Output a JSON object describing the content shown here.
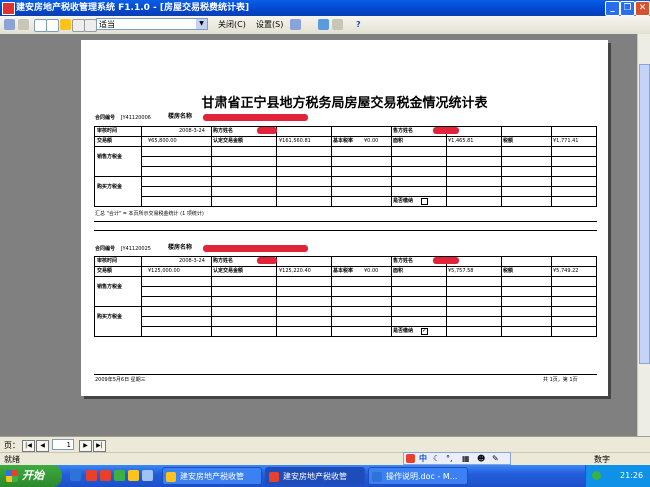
{
  "window": {
    "title": "建安房地产税收管理系统 F1.1.0 - [房屋交易税费统计表]",
    "minimize_icon": "minimize-icon",
    "maximize_icon": "restore-icon",
    "close_icon": "close-icon"
  },
  "toolbar": {
    "zoom_value": "适当",
    "close_label": "关闭(C)",
    "setup_label": "设置(S)",
    "help_glyph": "?"
  },
  "report": {
    "title": "甘肃省正宁县地方税务局房屋交易税金情况统计表",
    "footer_left": "2009年5月6日 星期三",
    "footer_right": "共 1页，第 1页",
    "record1": {
      "contract_no_label": "合同编号",
      "contract_no": "JY41120006",
      "building_label": "楼房名称",
      "header_row": [
        "审核时间",
        "2008-3-24",
        "购方姓名",
        "",
        "售方姓名",
        ""
      ],
      "amount_row": [
        "交易额",
        "¥65,800.00",
        "认定交易金额",
        "¥161,560.81",
        "基本税率",
        "¥0.00",
        "面积",
        "¥1,465.81",
        "税额",
        "¥1,771.41"
      ],
      "seller_group": "销售方税金",
      "buyer_group": "购买方税金",
      "check_label": "是否缴纳"
    },
    "middle_note": "汇总 \"合计\" = 本页所示交易税金统计 (1 项统计)",
    "record2": {
      "contract_no_label": "合同编号",
      "contract_no": "JY41120025",
      "building_label": "楼房名称",
      "header_row": [
        "审核时间",
        "2008-3-24",
        "购方姓名",
        "",
        "售方姓名",
        ""
      ],
      "amount_row": [
        "交易额",
        "¥125,000.00",
        "认定交易金额",
        "¥125,220.40",
        "基本税率",
        "¥0.00",
        "面积",
        "¥5,757.58",
        "税额",
        "¥5,749.22"
      ],
      "seller_group": "销售方税金",
      "buyer_group": "购买方税金",
      "check_label": "是否缴纳"
    }
  },
  "navigation": {
    "page_label": "页：",
    "page_number": "1"
  },
  "status": {
    "ready": "就绪",
    "mode": "数字"
  },
  "ime": {
    "lang": "中",
    "icons": [
      "moon-icon",
      "punctuation-icon",
      "keyboard-icon",
      "user-icon",
      "settings-icon"
    ]
  },
  "taskbar": {
    "start_label": "开始",
    "tasks": [
      {
        "label": "建安房地产税收管",
        "icon": "folder-icon"
      },
      {
        "label": "建安房地产税收管",
        "icon": "app-icon"
      },
      {
        "label": "操作说明.doc - M...",
        "icon": "word-icon"
      }
    ],
    "clock": "21:26"
  }
}
